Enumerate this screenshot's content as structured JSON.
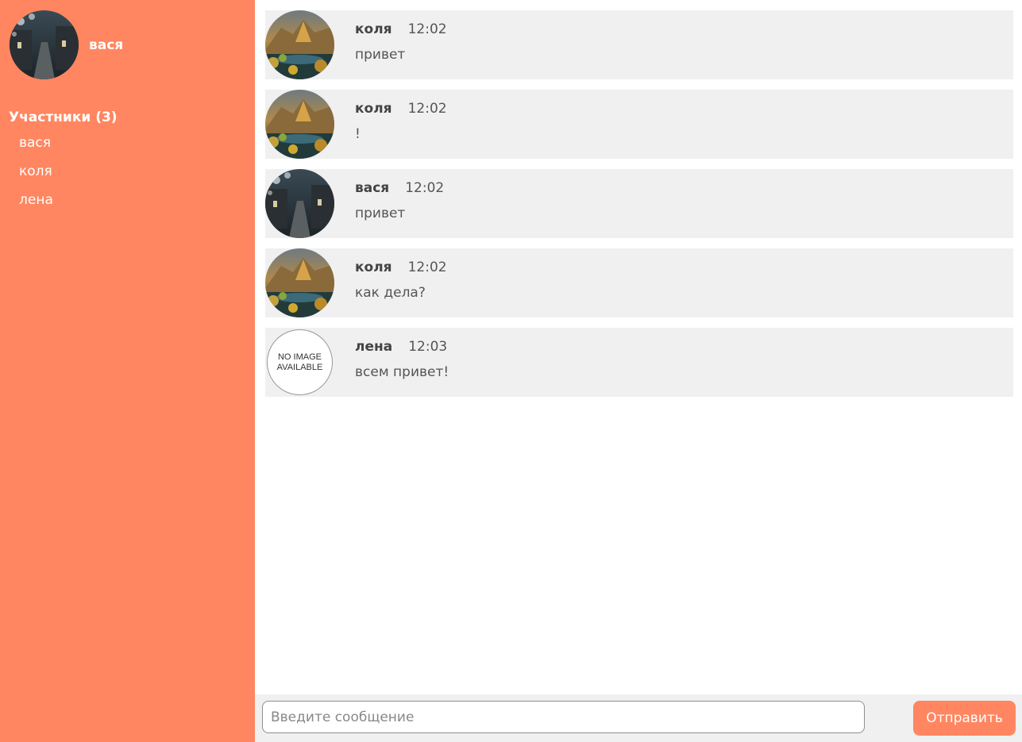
{
  "current_user": {
    "name": "вася",
    "avatar": "street-photo"
  },
  "participants": {
    "title": "Участники (3)",
    "items": [
      {
        "name": "вася"
      },
      {
        "name": "коля"
      },
      {
        "name": "лена"
      }
    ]
  },
  "messages": [
    {
      "author": "коля",
      "time": "12:02",
      "text": "привет",
      "avatar": "mountain-photo"
    },
    {
      "author": "коля",
      "time": "12:02",
      "text": "!",
      "avatar": "mountain-photo"
    },
    {
      "author": "вася",
      "time": "12:02",
      "text": "привет",
      "avatar": "street-photo"
    },
    {
      "author": "коля",
      "time": "12:02",
      "text": "как дела?",
      "avatar": "mountain-photo"
    },
    {
      "author": "лена",
      "time": "12:03",
      "text": "всем привет!",
      "avatar": "no-image",
      "avatar_text": [
        "NO IMAGE",
        "AVAILABLE"
      ]
    }
  ],
  "composer": {
    "placeholder": "Введите сообщение",
    "value": "",
    "send_label": "Отправить"
  },
  "colors": {
    "accent": "#ff8660",
    "message_bg": "#f0f0f0"
  }
}
